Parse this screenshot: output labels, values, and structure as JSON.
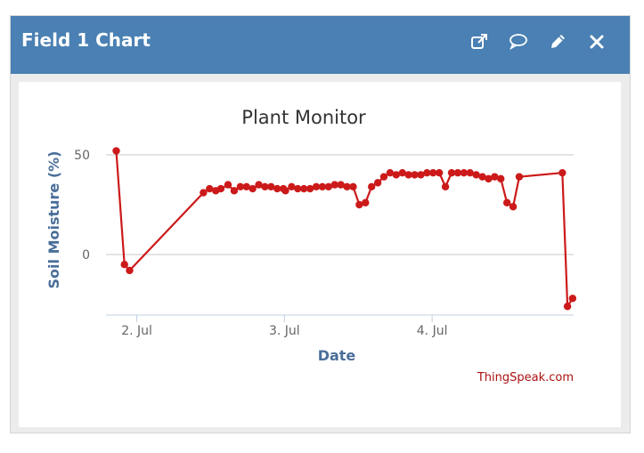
{
  "widget": {
    "title": "Field 1 Chart",
    "icons": [
      "external-link-icon",
      "comment-icon",
      "pencil-icon",
      "close-icon"
    ]
  },
  "chart_data": {
    "type": "line",
    "title": "Plant Monitor",
    "xlabel": "Date",
    "ylabel": "Soil Moisture (%)",
    "credit": "ThingSpeak.com",
    "y_ticks": [
      50,
      0
    ],
    "x_ticks": [
      {
        "label": "2. Jul",
        "t": "2023-07-02T00:00"
      },
      {
        "label": "3. Jul",
        "t": "2023-07-03T00:00"
      },
      {
        "label": "4. Jul",
        "t": "2023-07-04T00:00"
      }
    ],
    "xlim": [
      "2023-07-01T19:00",
      "2023-07-04T23:00"
    ],
    "ylim": [
      -30,
      50
    ],
    "grid": true,
    "line_color": "#cc1a1a",
    "x": [
      "2023-07-01T20:40",
      "2023-07-01T22:00",
      "2023-07-01T22:50",
      "2023-07-02T10:50",
      "2023-07-02T11:50",
      "2023-07-02T12:50",
      "2023-07-02T13:40",
      "2023-07-02T14:50",
      "2023-07-02T15:50",
      "2023-07-02T16:50",
      "2023-07-02T17:50",
      "2023-07-02T18:50",
      "2023-07-02T19:50",
      "2023-07-02T20:50",
      "2023-07-02T21:50",
      "2023-07-02T22:50",
      "2023-07-02T23:50",
      "2023-07-03T00:10",
      "2023-07-03T01:10",
      "2023-07-03T02:10",
      "2023-07-03T03:10",
      "2023-07-03T04:10",
      "2023-07-03T05:10",
      "2023-07-03T06:10",
      "2023-07-03T07:10",
      "2023-07-03T08:10",
      "2023-07-03T09:10",
      "2023-07-03T10:10",
      "2023-07-03T11:10",
      "2023-07-03T12:10",
      "2023-07-03T13:10",
      "2023-07-03T14:10",
      "2023-07-03T15:10",
      "2023-07-03T16:10",
      "2023-07-03T17:10",
      "2023-07-03T18:10",
      "2023-07-03T19:10",
      "2023-07-03T20:10",
      "2023-07-03T21:10",
      "2023-07-03T22:10",
      "2023-07-03T23:10",
      "2023-07-04T00:10",
      "2023-07-04T01:10",
      "2023-07-04T02:10",
      "2023-07-04T03:10",
      "2023-07-04T04:10",
      "2023-07-04T05:10",
      "2023-07-04T06:10",
      "2023-07-04T07:10",
      "2023-07-04T08:10",
      "2023-07-04T09:10",
      "2023-07-04T10:10",
      "2023-07-04T11:10",
      "2023-07-04T12:10",
      "2023-07-04T13:10",
      "2023-07-04T14:10",
      "2023-07-04T21:10",
      "2023-07-04T22:00",
      "2023-07-04T22:50"
    ],
    "y": [
      52,
      -5,
      -8,
      31,
      33,
      32,
      33,
      35,
      32,
      34,
      34,
      33,
      35,
      34,
      34,
      33,
      33,
      32,
      34,
      33,
      33,
      33,
      34,
      34,
      34,
      35,
      35,
      34,
      34,
      25,
      26,
      34,
      36,
      39,
      41,
      40,
      41,
      40,
      40,
      40,
      41,
      41,
      41,
      34,
      41,
      41,
      41,
      41,
      40,
      39,
      38,
      39,
      38,
      26,
      24,
      39,
      41,
      -26,
      -22,
      -19
    ]
  }
}
